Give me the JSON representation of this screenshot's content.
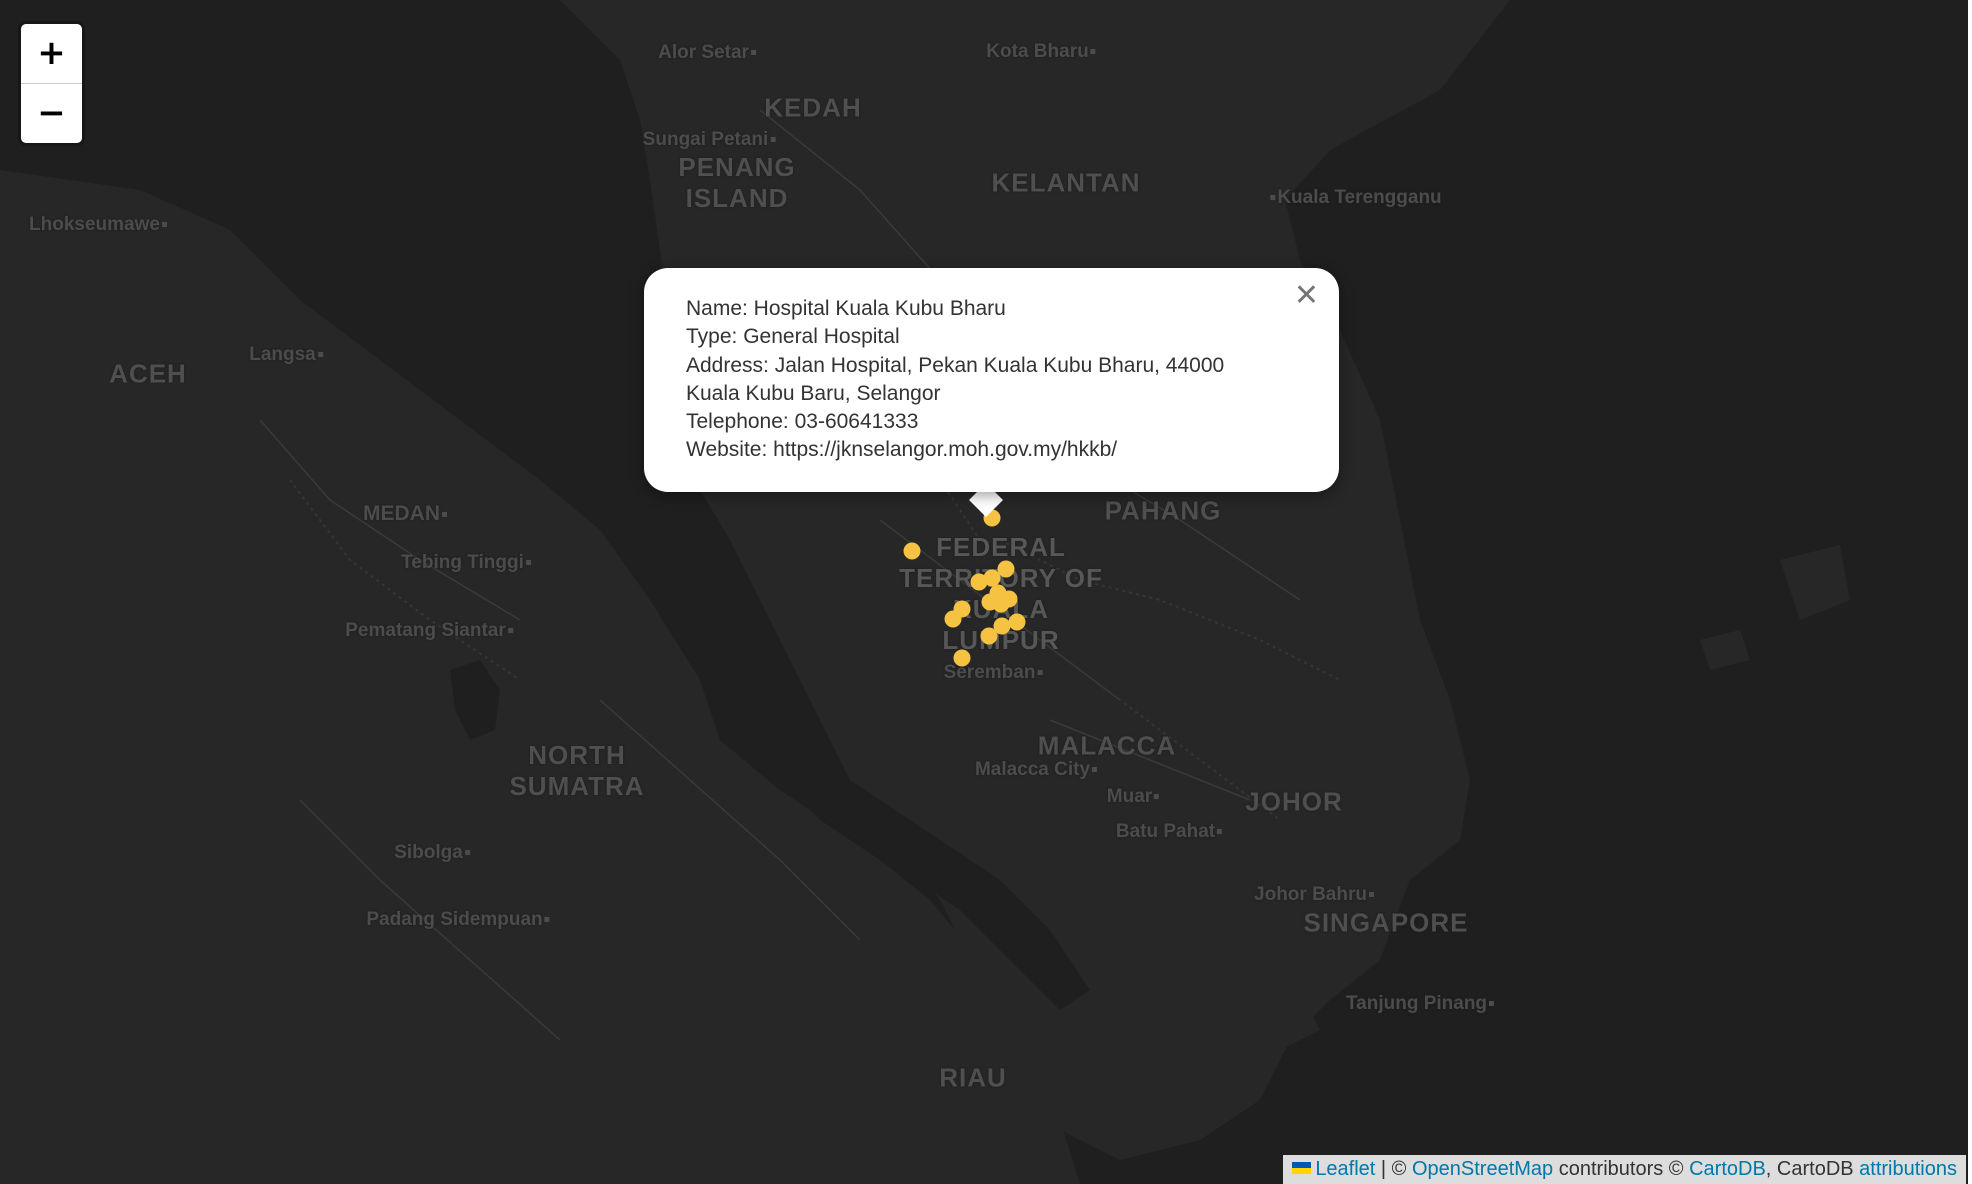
{
  "map": {
    "marker_color": "#f5c242",
    "land_color": "#262626",
    "water_color": "#1f1f1f",
    "boundary_color": "#3c3c3c",
    "road_color": "#3a3a3a"
  },
  "zoom": {
    "in_label": "+",
    "out_label": "−"
  },
  "popup": {
    "close_label": "✕",
    "name": "Name: Hospital Kuala Kubu Bharu",
    "type": "Type: General Hospital",
    "address_line1": "Address: Jalan Hospital, Pekan Kuala Kubu Bharu, 44000",
    "address_line2": "Kuala Kubu Baru, Selangor",
    "telephone": "Telephone: 03-60641333",
    "website": "Website: https://jknselangor.moh.gov.my/hkkb/"
  },
  "labels": {
    "regions": [
      "KEDAH",
      "PENANG\nISLAND",
      "KELANTAN",
      "ACEH",
      "PAHANG",
      "FEDERAL\nTERRITORY OF\nKUALA\nLUMPUR",
      "MALACCA",
      "JOHOR",
      "NORTH\nSUMATRA",
      "SINGAPORE",
      "RIAU"
    ],
    "cities": [
      "Alor Setar",
      "Kota Bharu",
      "Sungai Petani",
      "Kuala Terengganu",
      "Lhokseumawe",
      "Langsa",
      "MEDAN",
      "Tebing Tinggi",
      "Pematang Siantar",
      "Seremban",
      "Malacca City",
      "Muar",
      "Batu Pahat",
      "Johor Bahru",
      "Sibolga",
      "Padang Sidempuan",
      "Tanjung Pinang"
    ]
  },
  "attribution": {
    "leaflet": "Leaflet",
    "sep1": " | © ",
    "osm": "OpenStreetMap",
    "contrib": " contributors © ",
    "carto": "CartoDB",
    "sep2": ", CartoDB ",
    "attributions": "attributions"
  }
}
